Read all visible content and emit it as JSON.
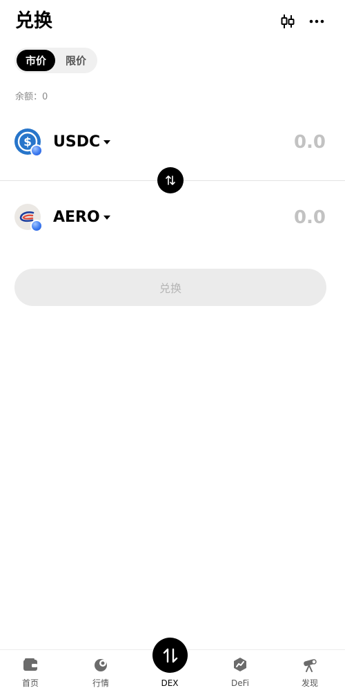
{
  "header": {
    "title": "兑换",
    "chart_icon": "candlestick-chart-icon",
    "more_icon": "more-horizontal-icon"
  },
  "order_tabs": [
    {
      "label": "市价",
      "active": true
    },
    {
      "label": "限价",
      "active": false
    }
  ],
  "balance_text": "余额：0",
  "from_token": {
    "symbol": "USDC",
    "amount_placeholder": "0.0",
    "logo_color": "#2775ca"
  },
  "to_token": {
    "symbol": "AERO",
    "amount_placeholder": "0.0"
  },
  "swap_button_label": "兑换",
  "bottom_nav": [
    {
      "label": "首页",
      "icon": "wallet-icon",
      "active": false
    },
    {
      "label": "行情",
      "icon": "market-icon",
      "active": false
    },
    {
      "label": "DEX",
      "icon": "swap-arrows-icon",
      "active": true
    },
    {
      "label": "DeFi",
      "icon": "defi-icon",
      "active": false
    },
    {
      "label": "发现",
      "icon": "telescope-icon",
      "active": false
    }
  ],
  "colors": {
    "accent": "#000000",
    "disabled_button": "#ebebeb",
    "chain_badge": "#3f7cf0"
  }
}
